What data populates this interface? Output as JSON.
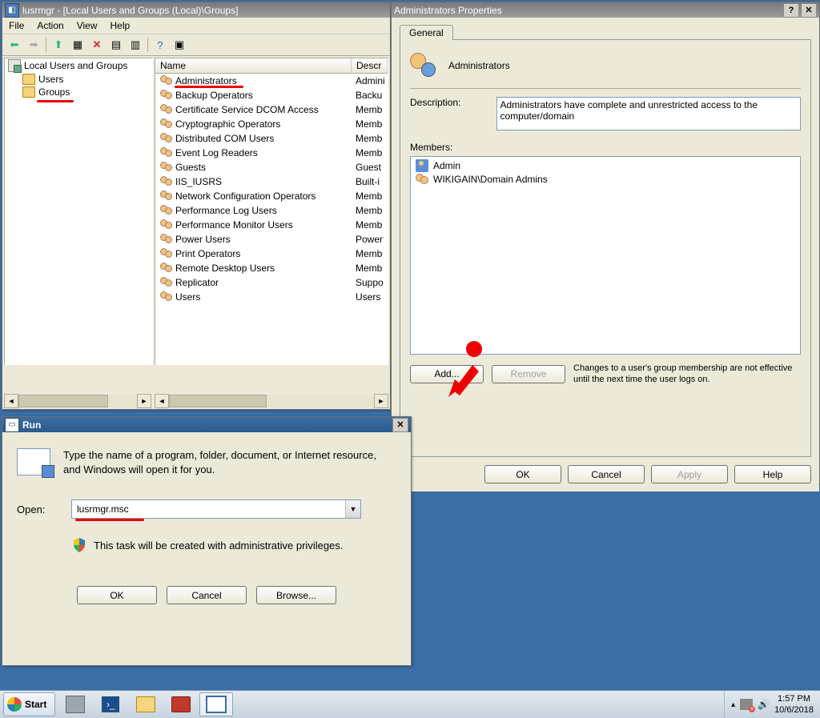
{
  "lusrmgr": {
    "title": "lusrmgr - [Local Users and Groups (Local)\\Groups]",
    "menus": [
      "File",
      "Action",
      "View",
      "Help"
    ],
    "tree": {
      "root": "Local Users and Groups",
      "users": "Users",
      "groups": "Groups"
    },
    "columns": {
      "name": "Name",
      "desc": "Descr"
    },
    "rows": [
      {
        "name": "Administrators",
        "desc": "Admini"
      },
      {
        "name": "Backup Operators",
        "desc": "Backu"
      },
      {
        "name": "Certificate Service DCOM Access",
        "desc": "Memb"
      },
      {
        "name": "Cryptographic Operators",
        "desc": "Memb"
      },
      {
        "name": "Distributed COM Users",
        "desc": "Memb"
      },
      {
        "name": "Event Log Readers",
        "desc": "Memb"
      },
      {
        "name": "Guests",
        "desc": "Guest"
      },
      {
        "name": "IIS_IUSRS",
        "desc": "Built-i"
      },
      {
        "name": "Network Configuration Operators",
        "desc": "Memb"
      },
      {
        "name": "Performance Log Users",
        "desc": "Memb"
      },
      {
        "name": "Performance Monitor Users",
        "desc": "Memb"
      },
      {
        "name": "Power Users",
        "desc": "Power"
      },
      {
        "name": "Print Operators",
        "desc": "Memb"
      },
      {
        "name": "Remote Desktop Users",
        "desc": "Memb"
      },
      {
        "name": "Replicator",
        "desc": "Suppo"
      },
      {
        "name": "Users",
        "desc": "Users"
      }
    ]
  },
  "props": {
    "title": "Administrators Properties",
    "tab_general": "General",
    "group_name": "Administrators",
    "desc_label": "Description:",
    "desc_value": "Administrators have complete and unrestricted access to the computer/domain",
    "members_label": "Members:",
    "members": [
      "Admin",
      "WIKIGAIN\\Domain Admins"
    ],
    "add": "Add...",
    "remove": "Remove",
    "note": "Changes to a user's group membership are not effective until the next time the user logs on.",
    "ok": "OK",
    "cancel": "Cancel",
    "apply": "Apply",
    "help": "Help"
  },
  "run": {
    "title": "Run",
    "hint": "Type the name of a program, folder, document, or Internet resource, and Windows will open it for you.",
    "open_label": "Open:",
    "value": "lusrmgr.msc",
    "admin_note": "This task will be created with administrative privileges.",
    "ok": "OK",
    "cancel": "Cancel",
    "browse": "Browse..."
  },
  "taskbar": {
    "start": "Start",
    "time": "1:57 PM",
    "date": "10/6/2018"
  }
}
